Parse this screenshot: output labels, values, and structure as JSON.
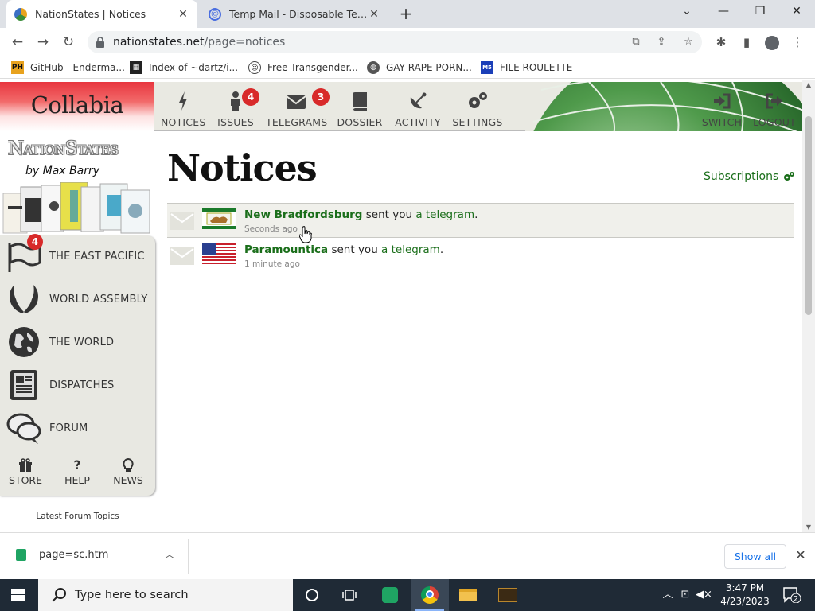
{
  "browser": {
    "tabs": [
      {
        "title": "NationStates | Notices",
        "active": true
      },
      {
        "title": "Temp Mail - Disposable Temporary Email",
        "active": false
      }
    ],
    "url_host": "nationstates.net",
    "url_path": "/page=notices",
    "bookmarks": [
      {
        "label": "GitHub - Enderma...",
        "icon": "ph-icon"
      },
      {
        "label": "Index of ~dartz/i...",
        "icon": "image-icon"
      },
      {
        "label": "Free Transgender...",
        "icon": "mask-icon"
      },
      {
        "label": "GAY RAPE PORN...",
        "icon": "globe-icon"
      },
      {
        "label": "FILE ROULETTE",
        "icon": "ms-icon"
      }
    ]
  },
  "banner": {
    "region_name": "Collabia",
    "nav": [
      {
        "label": "NOTICES",
        "icon": "lightning-icon"
      },
      {
        "label": "ISSUES",
        "icon": "person-icon",
        "badge": "4"
      },
      {
        "label": "TELEGRAMS",
        "icon": "envelope-icon",
        "badge": "3"
      },
      {
        "label": "DOSSIER",
        "icon": "book-icon"
      },
      {
        "label": "ACTIVITY",
        "icon": "satellite-icon"
      },
      {
        "label": "SETTINGS",
        "icon": "gears-icon"
      }
    ],
    "right_nav": [
      {
        "label": "SWITCH",
        "icon": "sign-in-icon"
      },
      {
        "label": "LOGOUT",
        "icon": "sign-out-icon"
      }
    ]
  },
  "sidebar": {
    "logo_text": "NationStates",
    "byline": "by Max Barry",
    "items": [
      {
        "label": "THE EAST PACIFIC",
        "icon": "flag-icon",
        "badge": "4"
      },
      {
        "label": "WORLD ASSEMBLY",
        "icon": "wreath-icon"
      },
      {
        "label": "THE WORLD",
        "icon": "globe-icon"
      },
      {
        "label": "DISPATCHES",
        "icon": "document-icon"
      },
      {
        "label": "FORUM",
        "icon": "speech-bubbles-icon"
      }
    ],
    "small_nav": [
      {
        "label": "STORE",
        "icon": "gift-icon"
      },
      {
        "label": "HELP",
        "icon": "question-icon"
      },
      {
        "label": "NEWS",
        "icon": "lightbulb-icon"
      }
    ],
    "forum_topics": "Latest Forum Topics"
  },
  "main": {
    "title": "Notices",
    "subscriptions": "Subscriptions",
    "notices": [
      {
        "nation": "New Bradfordsburg",
        "text": " sent you ",
        "link": "a telegram",
        "end": ".",
        "time": "Seconds ago"
      },
      {
        "nation": "Paramountica",
        "text": " sent you ",
        "link": "a telegram",
        "end": ".",
        "time": "1 minute ago"
      }
    ]
  },
  "downloads": {
    "file": "page=sc.htm",
    "show_all": "Show all"
  },
  "taskbar": {
    "search_placeholder": "Type here to search",
    "time": "3:47 PM",
    "date": "4/23/2023",
    "notification_count": "2"
  }
}
